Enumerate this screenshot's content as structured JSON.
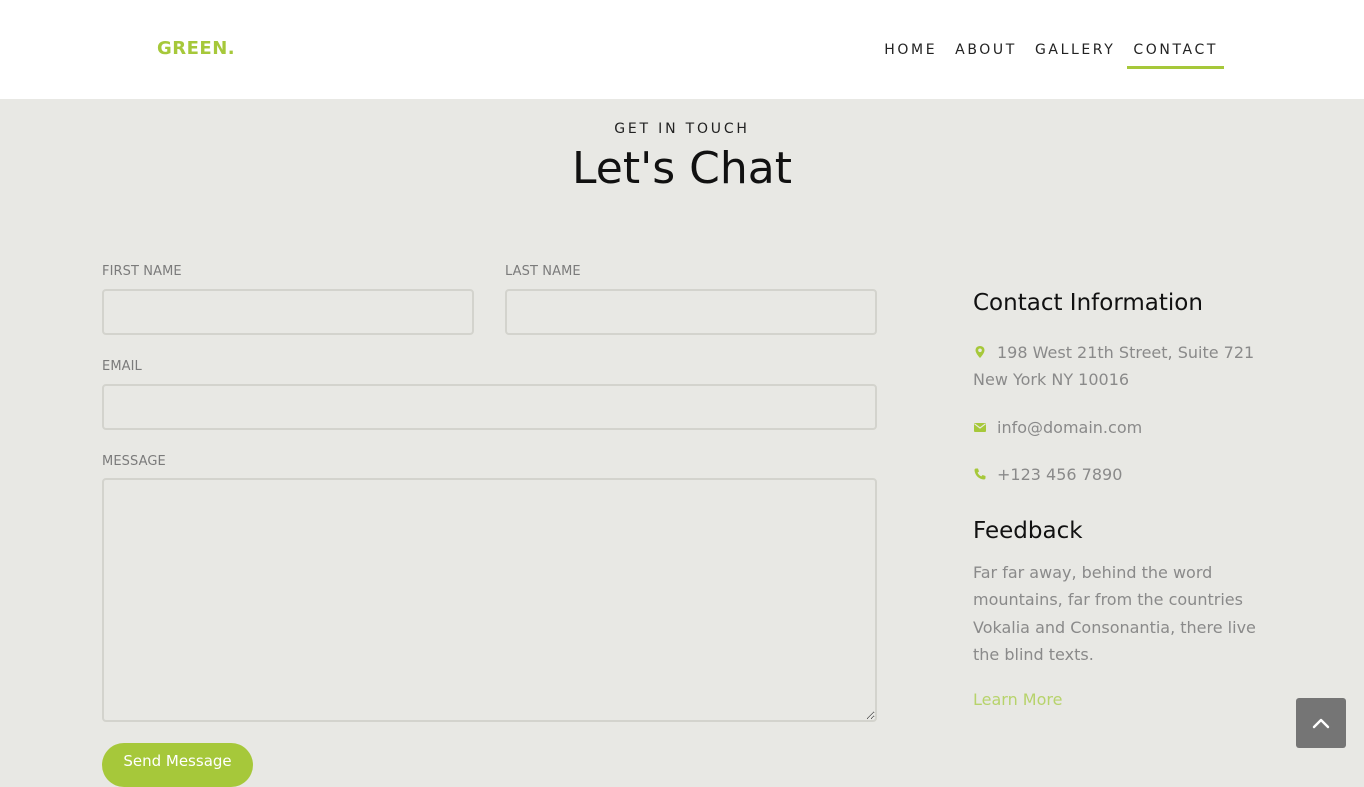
{
  "header": {
    "logo": "GREEN.",
    "nav": [
      {
        "label": "HOME",
        "active": false
      },
      {
        "label": "ABOUT",
        "active": false
      },
      {
        "label": "GALLERY",
        "active": false
      },
      {
        "label": "CONTACT",
        "active": true
      }
    ]
  },
  "hero": {
    "eyebrow": "GET IN TOUCH",
    "title": "Let's Chat"
  },
  "form": {
    "first_name_label": "FIRST NAME",
    "first_name_value": "",
    "last_name_label": "LAST NAME",
    "last_name_value": "",
    "email_label": "EMAIL",
    "email_value": "",
    "message_label": "MESSAGE",
    "message_value": "",
    "submit_label": "Send Message"
  },
  "contact": {
    "heading": "Contact Information",
    "address": "198 West 21th Street, Suite 721 New York NY 10016",
    "email": "info@domain.com",
    "phone": "+123 456 7890",
    "icons": [
      "map-pin-icon",
      "envelope-icon",
      "phone-icon"
    ]
  },
  "feedback": {
    "heading": "Feedback",
    "text": "Far far away, behind the word mountains, far from the countries Vokalia and Consonantia, there live the blind texts.",
    "link": "Learn More"
  },
  "colors": {
    "accent": "#a6c83a",
    "background": "#e8e8e4",
    "header_bg": "#ffffff",
    "to_top_bg": "#757575"
  }
}
